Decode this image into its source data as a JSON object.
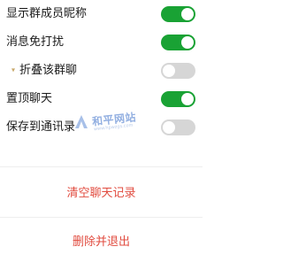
{
  "settings": [
    {
      "label": "显示群成员昵称",
      "on": true
    },
    {
      "label": "消息免打扰",
      "on": true
    },
    {
      "label": "折叠该群聊",
      "on": false
    },
    {
      "label": "置顶聊天",
      "on": true
    },
    {
      "label": "保存到通讯录",
      "on": false
    }
  ],
  "actions": {
    "clear_history": "清空聊天记录",
    "delete_and_exit": "删除并退出"
  },
  "watermark": {
    "text": "和平网站",
    "sub": "www.hpwzgs.com"
  },
  "colors": {
    "toggle_on": "#19a234",
    "toggle_off": "#d6d6d6",
    "danger": "#e14b3f"
  }
}
